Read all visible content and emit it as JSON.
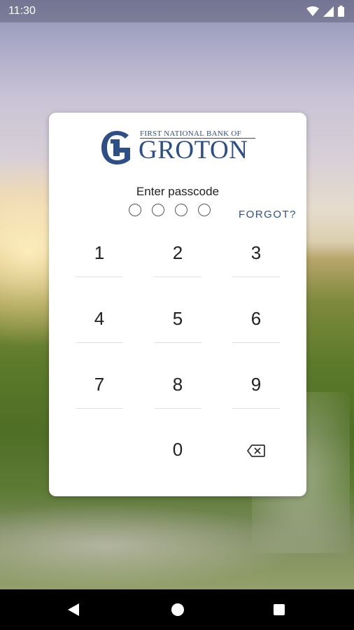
{
  "status": {
    "time": "11:30"
  },
  "logo": {
    "top_text": "FIRST NATIONAL BANK OF",
    "main_text": "GROTON"
  },
  "prompt": "Enter passcode",
  "forgot_label": "FORGOT?",
  "passcode": {
    "length": 4,
    "filled": 0
  },
  "keys": [
    "1",
    "2",
    "3",
    "4",
    "5",
    "6",
    "7",
    "8",
    "9",
    "0"
  ],
  "colors": {
    "brand": "#2d4f86"
  }
}
